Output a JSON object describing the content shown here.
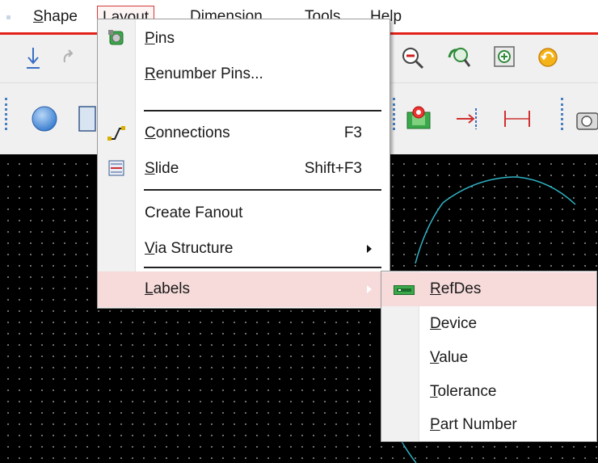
{
  "menubar": {
    "items": [
      {
        "label": "Shape",
        "mnemonic": "S",
        "rest": "hape"
      },
      {
        "label": "Layout",
        "mnemonic": "L",
        "rest": "ayout"
      },
      {
        "label": "Dimension",
        "pre": "D",
        "mnemonic": "i",
        "rest": "mension"
      },
      {
        "label": "Tools",
        "mnemonic": "T",
        "rest": "ools"
      },
      {
        "label": "Help",
        "mnemonic": "H",
        "rest": "elp"
      }
    ],
    "accent_color": "#e32119"
  },
  "layout_menu": {
    "items": [
      {
        "label": "Pins",
        "mnemonic": "P",
        "rest": "ins",
        "icon": "pins-icon"
      },
      {
        "label": "Renumber Pins...",
        "mnemonic": "R",
        "rest": "enumber Pins..."
      },
      {
        "label": "Connections",
        "mnemonic": "C",
        "rest": "onnections",
        "shortcut": "F3",
        "icon": "connections-icon"
      },
      {
        "label": "Slide",
        "mnemonic": "S",
        "rest": "lide",
        "shortcut": "Shift+F3",
        "icon": "slide-icon"
      },
      {
        "label": "Create Fanout"
      },
      {
        "label": "Via Structure",
        "mnemonic": "V",
        "rest": "ia Structure",
        "has_submenu": true
      },
      {
        "label": "Labels",
        "mnemonic": "L",
        "rest": "abels",
        "has_submenu": true,
        "highlighted": true
      }
    ]
  },
  "labels_submenu": {
    "items": [
      {
        "label": "RefDes",
        "mnemonic": "R",
        "rest": "efDes",
        "icon": "refdes-icon",
        "highlighted": true
      },
      {
        "label": "Device",
        "mnemonic": "D",
        "rest": "evice"
      },
      {
        "label": "Value",
        "mnemonic": "V",
        "rest": "alue"
      },
      {
        "label": "Tolerance",
        "mnemonic": "T",
        "rest": "olerance"
      },
      {
        "label": "Part Number",
        "mnemonic": "P",
        "rest": "art Number"
      }
    ]
  },
  "colors": {
    "highlight": "#f7dada",
    "canvas": "#000000",
    "trace": "#2fb3c4"
  }
}
